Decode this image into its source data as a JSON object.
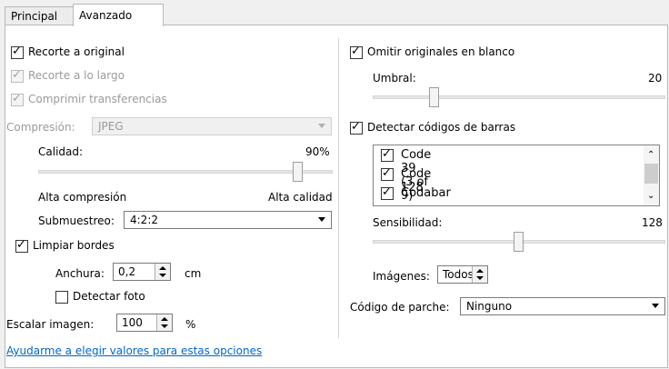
{
  "tabs": [
    {
      "label": "Principal"
    },
    {
      "label": "Avanzado"
    }
  ],
  "left": {
    "recorte_original": {
      "label": "Recorte a original",
      "checked": true
    },
    "recorte_largo": {
      "label": "Recorte a lo largo",
      "checked": true,
      "disabled": true
    },
    "comprimir": {
      "label": "Comprimir transferencias",
      "checked": true,
      "disabled": true
    },
    "compresion": {
      "label": "Compresión:",
      "value": "JPEG"
    },
    "calidad": {
      "label": "Calidad:",
      "value": "90%",
      "level": 0.9
    },
    "alta_compresion": "Alta compresión",
    "alta_calidad": "Alta calidad",
    "submuestreo": {
      "label": "Submuestreo:",
      "value": "4:2:2"
    },
    "limpiar_bordes": {
      "label": "Limpiar bordes",
      "checked": true
    },
    "anchura": {
      "label": "Anchura:",
      "value": "0,2",
      "unit": "cm"
    },
    "detectar_foto": {
      "label": "Detectar foto",
      "checked": false
    },
    "escalar": {
      "label": "Escalar imagen:",
      "value": "100",
      "unit": "%"
    },
    "help_link": "Ayudarme a elegir valores para estas opciones"
  },
  "right": {
    "omitir": {
      "label": "Omitir originales en blanco",
      "checked": true
    },
    "umbral": {
      "label": "Umbral:",
      "value": "20"
    },
    "detectar_codigos": {
      "label": "Detectar códigos de barras",
      "checked": true
    },
    "barcodes": [
      {
        "label": "Code 39 (3 of 9)",
        "checked": true
      },
      {
        "label": "Code 128",
        "checked": true
      },
      {
        "label": "Codabar",
        "checked": true
      }
    ],
    "sensibilidad": {
      "label": "Sensibilidad:",
      "value": "128"
    },
    "imagenes": {
      "label": "Imágenes:",
      "value": "Todos"
    },
    "codigo_parche": {
      "label": "Código de parche:",
      "value": "Ninguno"
    }
  }
}
